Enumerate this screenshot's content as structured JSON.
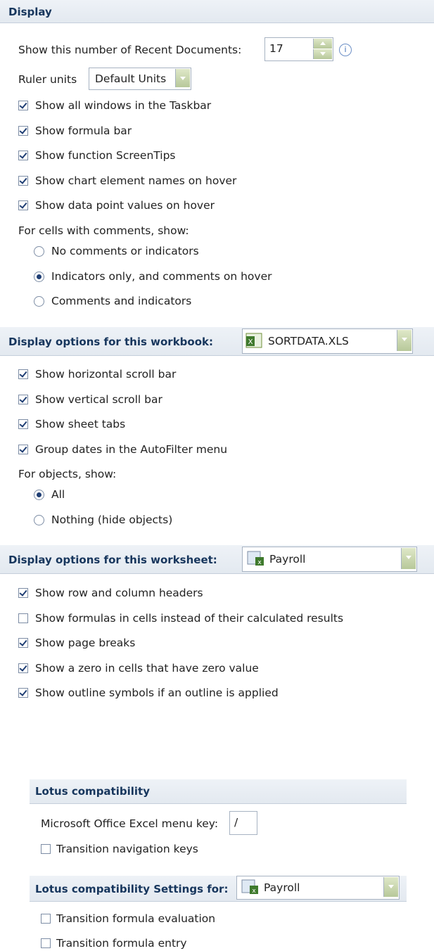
{
  "display": {
    "header": "Display",
    "recent_docs_label": "Show this number of Recent Documents:",
    "recent_docs_value": "17",
    "ruler_label": "Ruler units",
    "ruler_value": "Default Units",
    "checkboxes": [
      {
        "label": "Show all windows in the Taskbar",
        "checked": true
      },
      {
        "label": "Show formula bar",
        "checked": true
      },
      {
        "label": "Show function ScreenTips",
        "checked": true
      },
      {
        "label": "Show chart element names on hover",
        "checked": true
      },
      {
        "label": "Show data point values on hover",
        "checked": true
      }
    ],
    "comments_label": "For cells with comments, show:",
    "comment_options": [
      {
        "label": "No comments or indicators",
        "selected": false
      },
      {
        "label": "Indicators only, and comments on hover",
        "selected": true
      },
      {
        "label": "Comments and indicators",
        "selected": false
      }
    ]
  },
  "workbook": {
    "header": "Display options for this workbook:",
    "file": "SORTDATA.XLS",
    "checkboxes": [
      {
        "label": "Show horizontal scroll bar",
        "checked": true
      },
      {
        "label": "Show vertical scroll bar",
        "checked": true
      },
      {
        "label": "Show sheet tabs",
        "checked": true
      },
      {
        "label": "Group dates in the AutoFilter menu",
        "checked": true
      }
    ],
    "objects_label": "For objects, show:",
    "object_options": [
      {
        "label": "All",
        "selected": true
      },
      {
        "label": "Nothing (hide objects)",
        "selected": false
      }
    ]
  },
  "worksheet": {
    "header": "Display options for this worksheet:",
    "sheet": "Payroll",
    "checkboxes": [
      {
        "label": "Show row and column headers",
        "checked": true
      },
      {
        "label": "Show formulas in cells instead of their calculated results",
        "checked": false
      },
      {
        "label": "Show page breaks",
        "checked": true
      },
      {
        "label": "Show a zero in cells that have zero value",
        "checked": true
      },
      {
        "label": "Show outline symbols if an outline is applied",
        "checked": true
      }
    ]
  },
  "lotus": {
    "header": "Lotus compatibility",
    "menu_key_label": "Microsoft Office Excel menu key:",
    "menu_key_value": "/",
    "nav_keys_label": "Transition navigation keys",
    "settings_header": "Lotus compatibility Settings for:",
    "settings_sheet": "Payroll",
    "settings_checkboxes": [
      {
        "label": "Transition formula evaluation",
        "checked": false
      },
      {
        "label": "Transition formula entry",
        "checked": false
      }
    ]
  },
  "colors": {
    "header_text": "#17365d",
    "accent_green": "#6f8f3a"
  }
}
